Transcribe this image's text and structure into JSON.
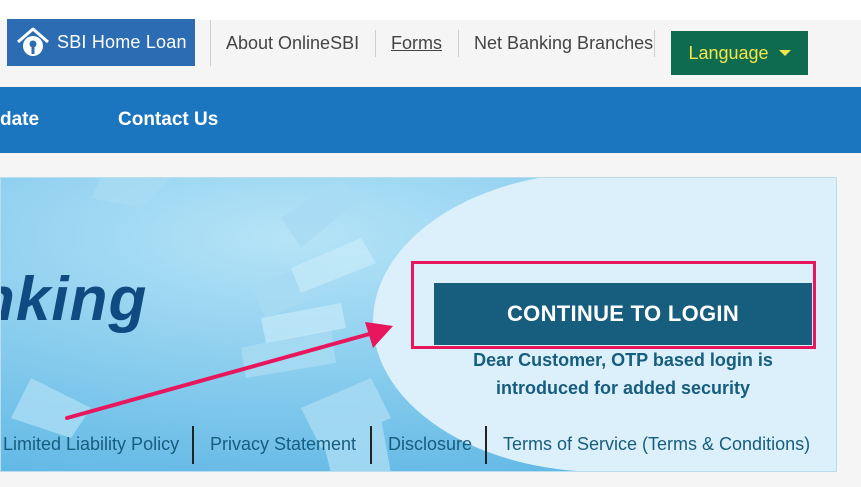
{
  "header": {
    "logo_text": "SBI Home Loan",
    "links": [
      {
        "label": "About OnlineSBI"
      },
      {
        "label": "Forms"
      },
      {
        "label": "Net Banking Branches"
      }
    ],
    "language_label": "Language"
  },
  "nav": {
    "items": [
      {
        "label": "date"
      },
      {
        "label": "Contact Us"
      }
    ]
  },
  "banner": {
    "banking_text": "nking",
    "login_button": "CONTINUE TO LOGIN",
    "otp_line1": "Dear Customer, OTP based login is",
    "otp_line2": "introduced for added security"
  },
  "footer": {
    "links": [
      {
        "label": "Limited Liability Policy"
      },
      {
        "label": "Privacy Statement"
      },
      {
        "label": "Disclosure"
      },
      {
        "label": "Terms of Service (Terms & Conditions)"
      }
    ]
  },
  "colors": {
    "nav_bg": "#1c75bf",
    "language_bg": "#0f6b4f",
    "language_text": "#f3e64a",
    "login_bg": "#175d7e",
    "annotation": "#e8175d"
  },
  "icons": {
    "logo": "sbi-house-keyhole-icon",
    "dropdown": "caret-down-icon",
    "annotation_arrow": "arrow-icon"
  }
}
